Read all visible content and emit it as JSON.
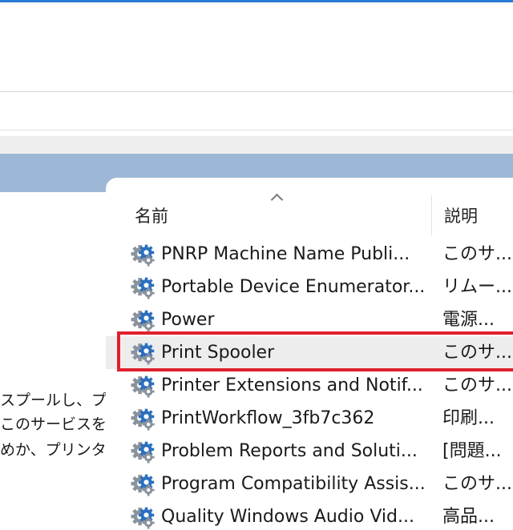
{
  "description_pane": {
    "lines": [
      "スプールし、プリ",
      "このサービスを",
      "めか、プリンター"
    ]
  },
  "services_list": {
    "columns": {
      "name": "名前",
      "description": "説明"
    },
    "rows": [
      {
        "name": "PNRP Machine Name Publi...",
        "description": "このサ..."
      },
      {
        "name": "Portable Device Enumerator...",
        "description": "リムー..."
      },
      {
        "name": "Power",
        "description": "電源..."
      },
      {
        "name": "Print Spooler",
        "description": "このサ...",
        "selected": true
      },
      {
        "name": "Printer Extensions and Notif...",
        "description": "このサ..."
      },
      {
        "name": "PrintWorkflow_3fb7c362",
        "description": "印刷..."
      },
      {
        "name": "Problem Reports and Soluti...",
        "description": "[問題..."
      },
      {
        "name": "Program Compatibility Assis...",
        "description": "このサ..."
      },
      {
        "name": "Quality Windows Audio Vid...",
        "description": "高品..."
      }
    ]
  },
  "colors": {
    "highlight": "#e0202d",
    "header_band": "#9db8d6",
    "icon_blue": "#2a6fbe",
    "icon_gray": "#8a929c"
  },
  "icons": {
    "service": "gear-icon",
    "sort": "sort-ascending-icon"
  }
}
